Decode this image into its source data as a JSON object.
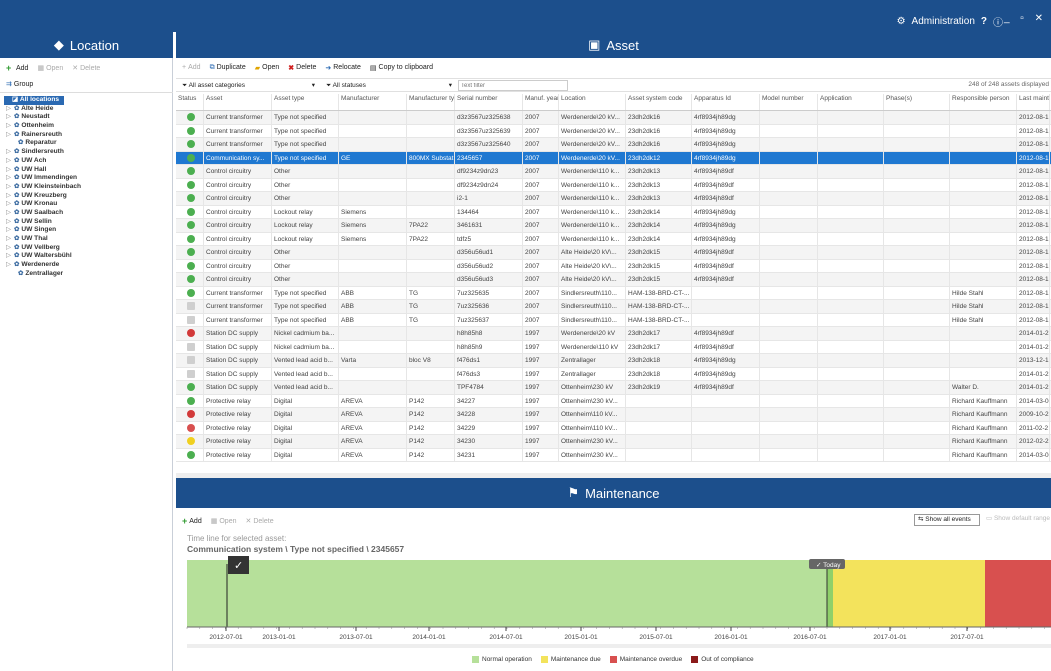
{
  "topbar": {
    "admin": "Administration",
    "help_glyph": "?",
    "info_glyph": "ⓘ",
    "window_controls": "_ ▫ ✕"
  },
  "location_panel": {
    "title": "Location",
    "toolbar": {
      "add": "Add",
      "open": "Open",
      "delete": "Delete",
      "group": "Group"
    },
    "tree": [
      {
        "label": "All locations",
        "level": 0,
        "root": true
      },
      {
        "label": "Alte Heide",
        "level": 1
      },
      {
        "label": "Neustadt",
        "level": 1
      },
      {
        "label": "Ottenheim",
        "level": 1
      },
      {
        "label": "Rainersreuth",
        "level": 1
      },
      {
        "label": "Reparatur",
        "level": 2
      },
      {
        "label": "Sindlersreuth",
        "level": 1
      },
      {
        "label": "UW Ach",
        "level": 1
      },
      {
        "label": "UW Hall",
        "level": 1
      },
      {
        "label": "UW Immendingen",
        "level": 1
      },
      {
        "label": "UW Kleinsteinbach",
        "level": 1
      },
      {
        "label": "UW Kreuzberg",
        "level": 1
      },
      {
        "label": "UW Kronau",
        "level": 1
      },
      {
        "label": "UW Saalbach",
        "level": 1
      },
      {
        "label": "UW Sellin",
        "level": 1
      },
      {
        "label": "UW Singen",
        "level": 1
      },
      {
        "label": "UW Thal",
        "level": 1
      },
      {
        "label": "UW Vellberg",
        "level": 1
      },
      {
        "label": "UW Waltersbühl",
        "level": 1
      },
      {
        "label": "Werdenerde",
        "level": 1
      },
      {
        "label": "Zentrallager",
        "level": 2
      }
    ]
  },
  "asset_panel": {
    "title": "Asset",
    "toolbar": {
      "add": "Add",
      "duplicate": "Duplicate",
      "open": "Open",
      "delete": "Delete",
      "relocate": "Relocate",
      "copy": "Copy to clipboard"
    },
    "filter_categories": "All asset categories",
    "filter_statuses": "All statuses",
    "filter_text_placeholder": "Text filter",
    "count": "248 of 248 assets displayed",
    "columns": [
      "Status",
      "Asset",
      "Asset type",
      "Manufacturer",
      "Manufacturer type",
      "Serial number",
      "Manuf. year",
      "Location",
      "Asset system code",
      "Apparatus Id",
      "Model number",
      "Application",
      "Phase(s)",
      "Responsible person",
      "Last maintenance"
    ],
    "rows": [
      {
        "st": "ok",
        "c": [
          "Current transformer",
          "Type not specified",
          "",
          "",
          "d3z3567uz325638",
          "2007",
          "Werdenerde\\20 kV...",
          "23dh2dk16",
          "4rf8934jh89dg",
          "",
          "",
          "",
          "",
          "2012-08-1"
        ]
      },
      {
        "st": "ok",
        "c": [
          "Current transformer",
          "Type not specified",
          "",
          "",
          "d3z3567uz325639",
          "2007",
          "Werdenerde\\20 kV...",
          "23dh2dk16",
          "4rf8934jh89dg",
          "",
          "",
          "",
          "",
          "2012-08-1"
        ]
      },
      {
        "st": "ok",
        "c": [
          "Current transformer",
          "Type not specified",
          "",
          "",
          "d3z3567uz325640",
          "2007",
          "Werdenerde\\20 kV...",
          "23dh2dk16",
          "4rf8934jh89dg",
          "",
          "",
          "",
          "",
          "2012-08-1"
        ]
      },
      {
        "st": "ok",
        "sel": true,
        "c": [
          "Communication sy...",
          "Type not specified",
          "GE",
          "800MX Substat...",
          "2345657",
          "2007",
          "Werdenerde\\20 kV...",
          "23dh2dk12",
          "4rf8934jh89dg",
          "",
          "",
          "",
          "",
          "2012-08-1"
        ]
      },
      {
        "st": "ok",
        "c": [
          "Control circuitry",
          "Other",
          "",
          "",
          "df9234z9dn23",
          "2007",
          "Werdenerde\\110 k...",
          "23dh2dk13",
          "4rf8934jh89df",
          "",
          "",
          "",
          "",
          "2012-08-1"
        ]
      },
      {
        "st": "ok",
        "c": [
          "Control circuitry",
          "Other",
          "",
          "",
          "df9234z9dn24",
          "2007",
          "Werdenerde\\110 k...",
          "23dh2dk13",
          "4rf8934jh89df",
          "",
          "",
          "",
          "",
          "2012-08-1"
        ]
      },
      {
        "st": "ok",
        "c": [
          "Control circuitry",
          "Other",
          "",
          "",
          "i2-1",
          "2007",
          "Werdenerde\\110 k...",
          "23dh2dk13",
          "4rf8934jh89df",
          "",
          "",
          "",
          "",
          "2012-08-1"
        ]
      },
      {
        "st": "ok",
        "c": [
          "Control circuitry",
          "Lockout relay",
          "Siemens",
          "",
          "134464",
          "2007",
          "Werdenerde\\110 k...",
          "23dh2dk14",
          "4rf8934jh89dg",
          "",
          "",
          "",
          "",
          "2012-08-1"
        ]
      },
      {
        "st": "ok",
        "c": [
          "Control circuitry",
          "Lockout relay",
          "Siemens",
          "7PA22",
          "3461631",
          "2007",
          "Werdenerde\\110 k...",
          "23dh2dk14",
          "4rf8934jh89dg",
          "",
          "",
          "",
          "",
          "2012-08-1"
        ]
      },
      {
        "st": "ok",
        "c": [
          "Control circuitry",
          "Lockout relay",
          "Siemens",
          "7PA22",
          "tdfz5",
          "2007",
          "Werdenerde\\110 k...",
          "23dh2dk14",
          "4rf8934jh89dg",
          "",
          "",
          "",
          "",
          "2012-08-1"
        ]
      },
      {
        "st": "ok",
        "c": [
          "Control circuitry",
          "Other",
          "",
          "",
          "d356u56ud1",
          "2007",
          "Alte Heide\\20 kV\\...",
          "23dh2dk15",
          "4rf8934jh89df",
          "",
          "",
          "",
          "",
          "2012-08-1"
        ]
      },
      {
        "st": "ok",
        "c": [
          "Control circuitry",
          "Other",
          "",
          "",
          "d356u56ud2",
          "2007",
          "Alte Heide\\20 kV\\...",
          "23dh2dk15",
          "4rf8934jh89df",
          "",
          "",
          "",
          "",
          "2012-08-1"
        ]
      },
      {
        "st": "ok",
        "c": [
          "Control circuitry",
          "Other",
          "",
          "",
          "d356u56ud3",
          "2007",
          "Alte Heide\\20 kV\\...",
          "23dh2dk15",
          "4rf8934jh89df",
          "",
          "",
          "",
          "",
          "2012-08-1"
        ]
      },
      {
        "st": "ok",
        "c": [
          "Current transformer",
          "Type not specified",
          "ABB",
          "TG",
          "7uz325635",
          "2007",
          "Sindlersreuth\\110...",
          "HAM-138-BRD-CT-...",
          "",
          "",
          "",
          "",
          "Hilde Stahl",
          "2012-08-1"
        ]
      },
      {
        "st": "na",
        "c": [
          "Current transformer",
          "Type not specified",
          "ABB",
          "TG",
          "7uz325636",
          "2007",
          "Sindlersreuth\\110...",
          "HAM-138-BRD-CT-...",
          "",
          "",
          "",
          "",
          "Hilde Stahl",
          "2012-08-1"
        ]
      },
      {
        "st": "na",
        "c": [
          "Current transformer",
          "Type not specified",
          "ABB",
          "TG",
          "7uz325637",
          "2007",
          "Sindlersreuth\\110...",
          "HAM-138-BRD-CT-...",
          "",
          "",
          "",
          "",
          "Hilde Stahl",
          "2012-08-1"
        ]
      },
      {
        "st": "bad",
        "c": [
          "Station DC supply",
          "Nickel cadmium ba...",
          "",
          "",
          "h8h85h8",
          "1997",
          "Werdenerde\\20 kV",
          "23dh2dk17",
          "4rf8934jh89df",
          "",
          "",
          "",
          "",
          "2014-01-2"
        ]
      },
      {
        "st": "na",
        "c": [
          "Station DC supply",
          "Nickel cadmium ba...",
          "",
          "",
          "h8h85h9",
          "1997",
          "Werdenerde\\110 kV",
          "23dh2dk17",
          "4rf8934jh89df",
          "",
          "",
          "",
          "",
          "2014-01-2"
        ]
      },
      {
        "st": "na",
        "c": [
          "Station DC supply",
          "Vented lead acid b...",
          "Varta",
          "bloc V8",
          "f476ds1",
          "1997",
          "Zentrallager",
          "23dh2dk18",
          "4rf8934jh89dg",
          "",
          "",
          "",
          "",
          "2013-12-1"
        ]
      },
      {
        "st": "na",
        "c": [
          "Station DC supply",
          "Vented lead acid b...",
          "",
          "",
          "f476ds3",
          "1997",
          "Zentrallager",
          "23dh2dk18",
          "4rf8934jh89dg",
          "",
          "",
          "",
          "",
          "2014-01-2"
        ]
      },
      {
        "st": "ok",
        "c": [
          "Station DC supply",
          "Vented lead acid b...",
          "",
          "",
          "TPF4784",
          "1997",
          "Ottenheim\\230 kV",
          "23dh2dk19",
          "4rf8934jh89df",
          "",
          "",
          "",
          "Walter D.",
          "2014-01-2"
        ]
      },
      {
        "st": "ok",
        "c": [
          "Protective relay",
          "Digital",
          "AREVA",
          "P142",
          "34227",
          "1997",
          "Ottenheim\\230 kV...",
          "",
          "",
          "",
          "",
          "",
          "Richard Kauffmann",
          "2014-03-0"
        ]
      },
      {
        "st": "bad",
        "c": [
          "Protective relay",
          "Digital",
          "AREVA",
          "P142",
          "34228",
          "1997",
          "Ottenheim\\110 kV...",
          "",
          "",
          "",
          "",
          "",
          "Richard Kauffmann",
          "2009-10-2"
        ]
      },
      {
        "st": "red",
        "c": [
          "Protective relay",
          "Digital",
          "AREVA",
          "P142",
          "34229",
          "1997",
          "Ottenheim\\110 kV...",
          "",
          "",
          "",
          "",
          "",
          "Richard Kauffmann",
          "2011-02-2"
        ]
      },
      {
        "st": "yel",
        "c": [
          "Protective relay",
          "Digital",
          "AREVA",
          "P142",
          "34230",
          "1997",
          "Ottenheim\\230 kV...",
          "",
          "",
          "",
          "",
          "",
          "Richard Kauffmann",
          "2012-02-2"
        ]
      },
      {
        "st": "ok",
        "c": [
          "Protective relay",
          "Digital",
          "AREVA",
          "P142",
          "34231",
          "1997",
          "Ottenheim\\230 kV...",
          "",
          "",
          "",
          "",
          "",
          "Richard Kauffmann",
          "2014-03-0"
        ]
      }
    ]
  },
  "maintenance_panel": {
    "title": "Maintenance",
    "toolbar": {
      "add": "Add",
      "open": "Open",
      "delete": "Delete",
      "show_all": "Show all events",
      "show_default": "Show default range"
    },
    "timeline_caption": "Time line for selected asset:",
    "timeline_asset": "Communication system \\ Type not specified \\ 2345657",
    "today_label": "Today",
    "axis_ticks": [
      "2012-07-01",
      "2013-01-01",
      "2013-07-01",
      "2014-01-01",
      "2014-07-01",
      "2015-01-01",
      "2015-07-01",
      "2016-01-01",
      "2016-07-01",
      "2017-01-01",
      "2017-07-01"
    ],
    "legend": [
      {
        "label": "Normal operation",
        "color": "#b6e09a"
      },
      {
        "label": "Maintenance due",
        "color": "#f3e35c"
      },
      {
        "label": "Maintenance overdue",
        "color": "#d8504f"
      },
      {
        "label": "Out of compliance",
        "color": "#8b1a1a"
      }
    ]
  }
}
